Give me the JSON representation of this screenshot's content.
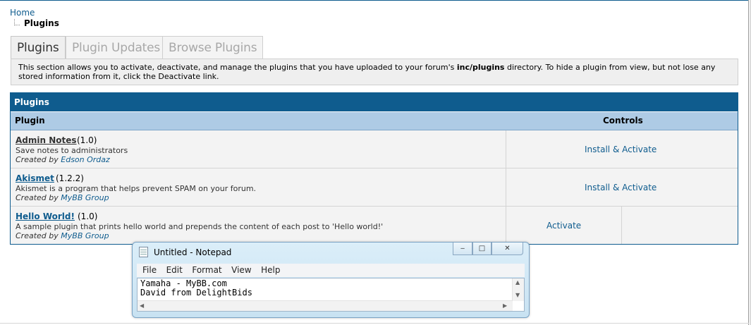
{
  "breadcrumb": {
    "home": "Home",
    "current": "Plugins"
  },
  "tabs": [
    {
      "label": "Plugins",
      "active": true
    },
    {
      "label": "Plugin Updates",
      "active": false
    },
    {
      "label": "Browse Plugins",
      "active": false
    }
  ],
  "description": {
    "before": "This section allows you to activate, deactivate, and manage the plugins that you have uploaded to your forum's ",
    "dir": "inc/plugins",
    "after": " directory. To hide a plugin from view, but not lose any stored information from it, click the Deactivate link."
  },
  "panel": {
    "title": "Plugins",
    "col_plugin": "Plugin",
    "col_controls": "Controls",
    "created_by_label": "Created by",
    "plugins": [
      {
        "name": "Admin Notes",
        "version": "(1.0)",
        "description": "Save notes to administrators",
        "author": "Edson Ordaz",
        "control": "Install & Activate"
      },
      {
        "name": "Akismet",
        "version": "(1.2.2)",
        "description": "Akismet is a program that helps prevent SPAM on your forum.",
        "author": "MyBB Group",
        "control": "Install & Activate"
      },
      {
        "name": "Hello World!",
        "version": "(1.0)",
        "description": "A sample plugin that prints hello world and prepends the content of each post to 'Hello world!'",
        "author": "MyBB Group",
        "control": "Activate"
      }
    ]
  },
  "notepad": {
    "title": "Untitled - Notepad",
    "menu": [
      "File",
      "Edit",
      "Format",
      "View",
      "Help"
    ],
    "text_line1": "Yamaha - MyBB.com",
    "text_line2": "David from DelightBids",
    "buttons": {
      "minimize": "‒",
      "maximize": "□",
      "close": "✕"
    },
    "icon": "notepad-icon"
  },
  "colors": {
    "accent": "#0f5c8e",
    "header_light": "#aecbe5",
    "row_bg": "#f3f3f3"
  }
}
